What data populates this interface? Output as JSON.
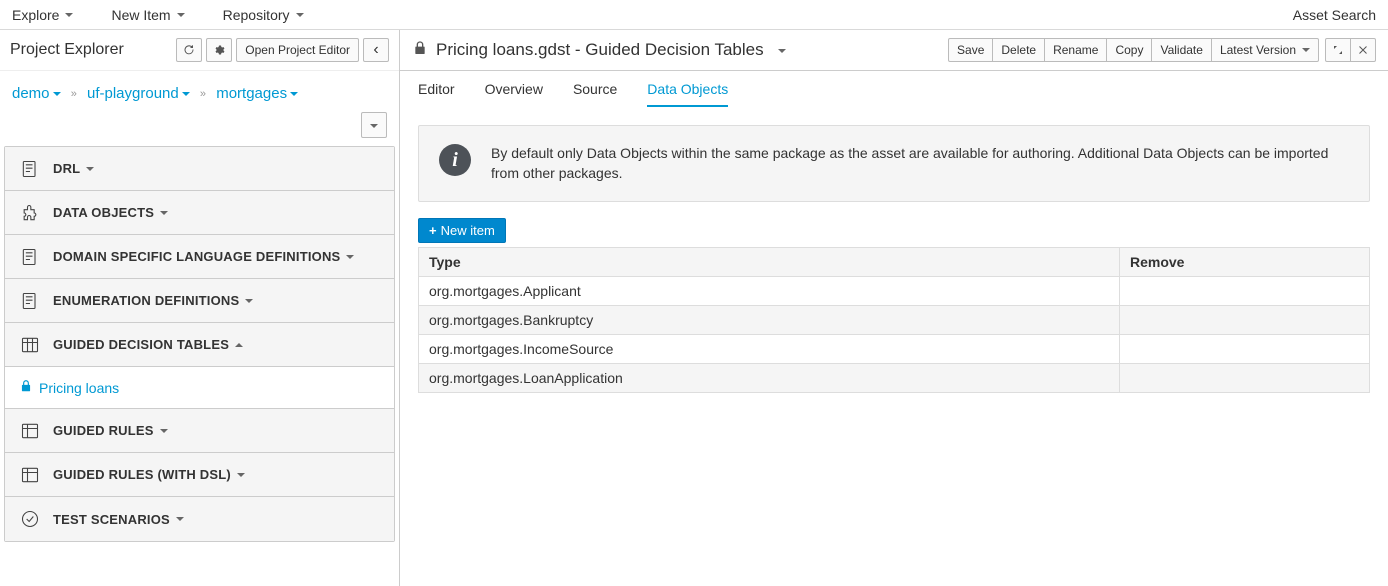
{
  "menubar": {
    "explore": "Explore",
    "new_item": "New Item",
    "repository": "Repository",
    "asset_search": "Asset Search"
  },
  "sidebar": {
    "title": "Project Explorer",
    "open_editor": "Open Project Editor",
    "breadcrumb": {
      "a": "demo",
      "b": "uf-playground",
      "c": "mortgages"
    },
    "sections": {
      "drl": "DRL",
      "data_objects": "DATA OBJECTS",
      "dsl": "DOMAIN SPECIFIC LANGUAGE DEFINITIONS",
      "enum": "ENUMERATION DEFINITIONS",
      "gdt": "GUIDED DECISION TABLES",
      "guided_rules": "GUIDED RULES",
      "guided_rules_dsl": "GUIDED RULES (WITH DSL)",
      "test_scenarios": "TEST SCENARIOS"
    },
    "gdt_file": "Pricing loans"
  },
  "content": {
    "title": "Pricing loans.gdst - Guided Decision Tables",
    "actions": {
      "save": "Save",
      "delete": "Delete",
      "rename": "Rename",
      "copy": "Copy",
      "validate": "Validate",
      "latest_version": "Latest Version"
    },
    "tabs": {
      "editor": "Editor",
      "overview": "Overview",
      "source": "Source",
      "data_objects": "Data Objects"
    },
    "info": "By default only Data Objects within the same package as the asset are available for authoring. Additional Data Objects can be imported from other packages.",
    "new_item": "New item",
    "table": {
      "col_type": "Type",
      "col_remove": "Remove",
      "rows": [
        "org.mortgages.Applicant",
        "org.mortgages.Bankruptcy",
        "org.mortgages.IncomeSource",
        "org.mortgages.LoanApplication"
      ]
    }
  }
}
